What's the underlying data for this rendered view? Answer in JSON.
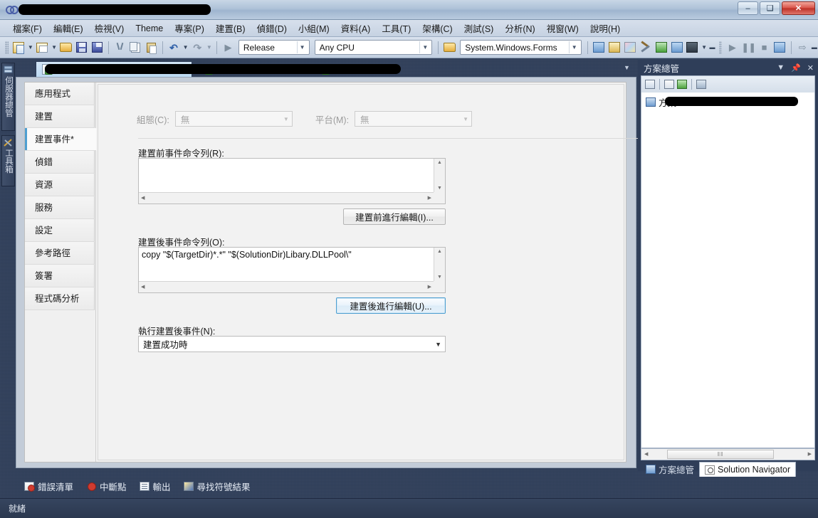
{
  "window": {
    "title_redacted": true,
    "logo_icon": "visual-studio-logo",
    "minimize_label": "–",
    "maximize_label": "❑",
    "close_label": "✕"
  },
  "menubar": {
    "items": [
      {
        "label": "檔案(F)",
        "name": "menu-file"
      },
      {
        "label": "編輯(E)",
        "name": "menu-edit"
      },
      {
        "label": "檢視(V)",
        "name": "menu-view"
      },
      {
        "label": "Theme",
        "name": "menu-theme"
      },
      {
        "label": "專案(P)",
        "name": "menu-project"
      },
      {
        "label": "建置(B)",
        "name": "menu-build"
      },
      {
        "label": "偵錯(D)",
        "name": "menu-debug"
      },
      {
        "label": "小組(M)",
        "name": "menu-team"
      },
      {
        "label": "資料(A)",
        "name": "menu-data"
      },
      {
        "label": "工具(T)",
        "name": "menu-tools"
      },
      {
        "label": "架構(C)",
        "name": "menu-architecture"
      },
      {
        "label": "測試(S)",
        "name": "menu-test"
      },
      {
        "label": "分析(N)",
        "name": "menu-analyze"
      },
      {
        "label": "視窗(W)",
        "name": "menu-window"
      },
      {
        "label": "說明(H)",
        "name": "menu-help"
      }
    ]
  },
  "toolbar": {
    "configuration": "Release",
    "platform": "Any CPU",
    "assembly": "System.Windows.Forms",
    "icons": [
      "new-project-icon",
      "add-new-item-icon",
      "open-file-icon",
      "save-icon",
      "save-all-icon",
      "cut-icon",
      "copy-icon",
      "paste-icon",
      "undo-icon",
      "redo-icon",
      "start-debug-icon",
      "find-in-files-icon",
      "properties-window-icon",
      "object-browser-icon",
      "toolbox-icon",
      "step-into-icon",
      "solution-explorer-icon",
      "command-window-icon",
      "pause-icon",
      "stop-icon",
      "restart-icon",
      "step-over-icon"
    ]
  },
  "left_dock": {
    "tabs": [
      {
        "label": "伺服器總管",
        "icon": "server-explorer-icon"
      },
      {
        "label": "工具箱",
        "icon": "toolbox-icon"
      }
    ]
  },
  "document_tabs": {
    "redacted": true,
    "tabs": [
      {
        "name": "tab-document-1",
        "icon": "csharp-file-icon",
        "active": true,
        "label": ""
      },
      {
        "name": "tab-document-2",
        "icon": "windows-form-icon",
        "active": false,
        "label": ""
      },
      {
        "name": "tab-document-3",
        "icon": "windows-form-icon",
        "active": false,
        "label": ""
      }
    ],
    "overflow_icon": "chevron-down-icon"
  },
  "property_page": {
    "categories": [
      {
        "label": "應用程式",
        "name": "category-application",
        "selected": false
      },
      {
        "label": "建置",
        "name": "category-build",
        "selected": false
      },
      {
        "label": "建置事件*",
        "name": "category-build-events",
        "selected": true
      },
      {
        "label": "偵錯",
        "name": "category-debug",
        "selected": false
      },
      {
        "label": "資源",
        "name": "category-resources",
        "selected": false
      },
      {
        "label": "服務",
        "name": "category-services",
        "selected": false
      },
      {
        "label": "設定",
        "name": "category-settings",
        "selected": false
      },
      {
        "label": "參考路徑",
        "name": "category-reference-paths",
        "selected": false
      },
      {
        "label": "簽署",
        "name": "category-signing",
        "selected": false
      },
      {
        "label": "程式碼分析",
        "name": "category-code-analysis",
        "selected": false
      }
    ],
    "configuration_label": "組態(C):",
    "configuration_value": "無",
    "platform_label": "平台(M):",
    "platform_value": "無",
    "prebuild_label": "建置前事件命令列(R):",
    "prebuild_value": "",
    "prebuild_button": "建置前進行編輯(I)...",
    "postbuild_label": "建置後事件命令列(O):",
    "postbuild_value": "copy \"$(TargetDir)*.*\" \"$(SolutionDir)Libary.DLLPool\\\"",
    "postbuild_button": "建置後進行編輯(U)...",
    "runpostbuild_label": "執行建置後事件(N):",
    "runpostbuild_value": "建置成功時"
  },
  "solution_explorer": {
    "title": "方案總管",
    "dropdown_icon": "chevron-down-icon",
    "pin_icon": "pin-icon",
    "close_icon": "close-icon",
    "toolbar_icons": [
      "properties-icon",
      "show-all-files-icon",
      "refresh-icon",
      "view-class-diagram-icon"
    ],
    "tree": {
      "root_prefix": "方案",
      "root_redacted": true,
      "icon": "solution-icon"
    },
    "hscroll_thumb_glyph": "‖‖",
    "tabs": [
      {
        "label": "方案總管",
        "icon": "solution-explorer-icon",
        "active": false
      },
      {
        "label": "Solution Navigator",
        "icon": "solution-navigator-icon",
        "active": true
      }
    ]
  },
  "bottom_dock": {
    "tabs": [
      {
        "label": "錯誤清單",
        "icon": "error-list-icon"
      },
      {
        "label": "中斷點",
        "icon": "breakpoints-icon"
      },
      {
        "label": "輸出",
        "icon": "output-icon"
      },
      {
        "label": "尋找符號結果",
        "icon": "find-symbol-results-icon"
      }
    ]
  },
  "statusbar": {
    "text": "就緒"
  },
  "colors": {
    "window_chrome": "#2d3c57",
    "title_bar": "#aec2d8",
    "accent_selected_tab": "#4e9fd1",
    "close_button": "#d9544a",
    "panel_background": "#f0f0f0"
  }
}
